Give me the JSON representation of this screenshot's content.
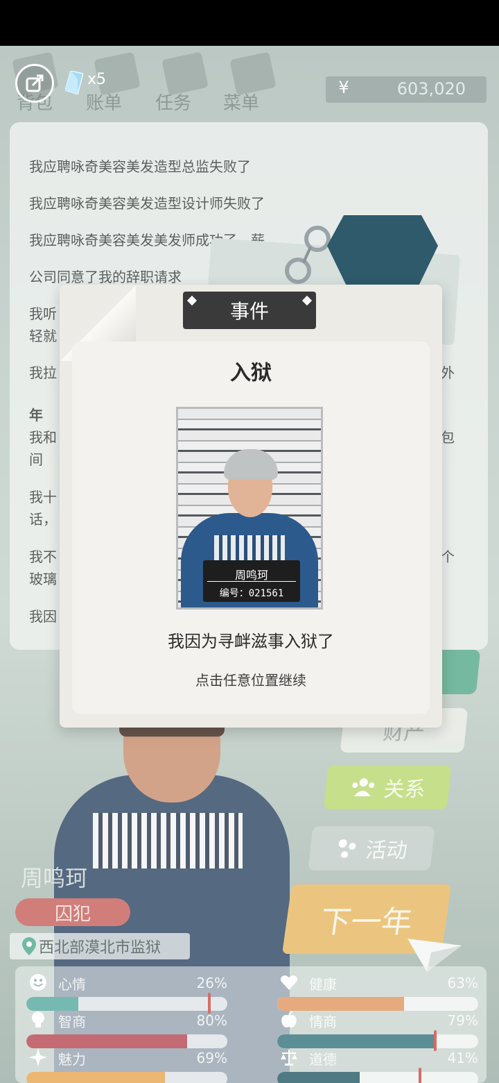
{
  "topnav": {
    "gem_count": "x5",
    "tabs": [
      "背包",
      "账单",
      "任务",
      "菜单"
    ],
    "money": "603,020",
    "currency_symbol": "¥"
  },
  "log": {
    "lines": [
      "我应聘咏奇美容美发造型总监失败了",
      "我应聘咏奇美容美发造型设计师失败了",
      "我应聘咏奇美容美发美发师成功了，薪",
      "公司同意了我的辞职请求",
      "我听",
      "轻就",
      "我拉",
      "年",
      "我和",
      "间",
      "我十",
      "话，",
      "我不",
      "玻璃",
      "我因"
    ],
    "right_fragments": [
      "外",
      "包",
      "个"
    ]
  },
  "side_buttons": {
    "assets": "财产",
    "relations": "关系",
    "activities": "活动"
  },
  "character": {
    "name": "周鸣珂",
    "role": "囚犯",
    "location": "西北部漠北市监狱"
  },
  "next_button": "下一年",
  "stats": [
    {
      "label": "心情",
      "value": "26%",
      "fill": 0.26,
      "color": "#4fa69c",
      "icon": "smile-icon"
    },
    {
      "label": "健康",
      "value": "63%",
      "fill": 0.63,
      "color": "#e0935a",
      "icon": "heart-icon"
    },
    {
      "label": "智商",
      "value": "80%",
      "fill": 0.8,
      "color": "#b2414c",
      "icon": "bulb-icon"
    },
    {
      "label": "情商",
      "value": "79%",
      "fill": 0.79,
      "color": "#2d6f78",
      "icon": "apple-icon"
    },
    {
      "label": "魅力",
      "value": "69%",
      "fill": 0.69,
      "color": "#e7a34c",
      "icon": "sparkle-icon"
    },
    {
      "label": "道德",
      "value": "41%",
      "fill": 0.41,
      "color": "#1f5560",
      "icon": "scale-icon"
    }
  ],
  "modal": {
    "header": "事件",
    "title": "入狱",
    "plate_name": "周鸣珂",
    "plate_id": "编号：021561",
    "message": "我因为寻衅滋事入狱了",
    "hint": "点击任意位置继续"
  }
}
